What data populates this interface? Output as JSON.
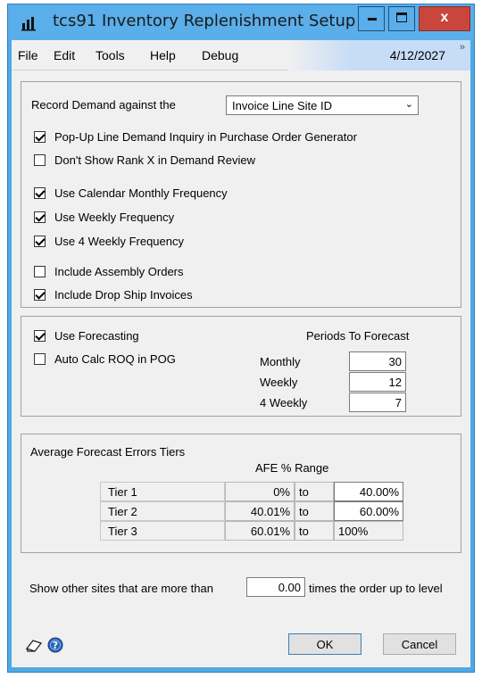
{
  "window": {
    "title": "tcs91 Inventory Replenishment Setup",
    "close_glyph": "x"
  },
  "menu": {
    "items": [
      "File",
      "Edit",
      "Tools",
      "Help",
      "Debug"
    ],
    "date": "4/12/2027",
    "chevron": "»"
  },
  "demand": {
    "label": "Record Demand against the",
    "selected": "Invoice Line Site ID"
  },
  "options": {
    "popup_inquiry": {
      "label": "Pop-Up Line Demand Inquiry in Purchase Order Generator",
      "checked": true
    },
    "dont_show_rank": {
      "label": "Don't Show Rank X in Demand Review",
      "checked": false
    },
    "calendar_monthly": {
      "label": "Use Calendar Monthly Frequency",
      "checked": true
    },
    "weekly": {
      "label": "Use Weekly Frequency",
      "checked": true
    },
    "four_weekly": {
      "label": "Use 4 Weekly Frequency",
      "checked": true
    },
    "assembly_orders": {
      "label": "Include Assembly Orders",
      "checked": false
    },
    "drop_ship": {
      "label": "Include Drop Ship Invoices",
      "checked": true
    }
  },
  "forecast": {
    "use_forecasting": {
      "label": "Use Forecasting",
      "checked": true
    },
    "auto_calc": {
      "label": "Auto Calc ROQ in POG",
      "checked": false
    },
    "periods_header": "Periods To Forecast",
    "monthly_label": "Monthly",
    "monthly_value": "30",
    "weekly_label": "Weekly",
    "weekly_value": "12",
    "four_weekly_label": "4 Weekly",
    "four_weekly_value": "7"
  },
  "afe": {
    "title": "Average Forecast Errors Tiers",
    "range_header": "AFE % Range",
    "to_label": "to",
    "tiers": [
      {
        "name": "Tier 1",
        "from": "0%",
        "to": "40.00%"
      },
      {
        "name": "Tier 2",
        "from": "40.01%",
        "to": "60.00%"
      },
      {
        "name": "Tier 3",
        "from": "60.01%",
        "to": "100%"
      }
    ]
  },
  "sites": {
    "prefix": "Show other sites that are more than",
    "value": "0.00",
    "suffix": "times  the order up to level"
  },
  "buttons": {
    "ok": "OK",
    "cancel": "Cancel"
  },
  "icons": {
    "app": "chart-icon",
    "note": "note-icon",
    "help": "help-icon"
  }
}
